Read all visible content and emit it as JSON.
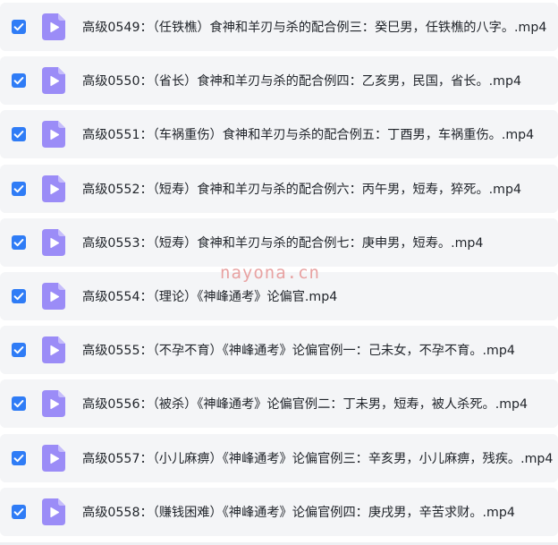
{
  "files": [
    {
      "checked": true,
      "name": "高级0549：（任铁樵）食神和羊刃与杀的配合例三：癸巳男，任铁樵的八字。.mp4"
    },
    {
      "checked": true,
      "name": "高级0550：（省长）食神和羊刃与杀的配合例四：乙亥男，民国，省长。.mp4"
    },
    {
      "checked": true,
      "name": "高级0551：（车祸重伤）食神和羊刃与杀的配合例五：丁酉男，车祸重伤。.mp4"
    },
    {
      "checked": true,
      "name": "高级0552：（短寿）食神和羊刃与杀的配合例六：丙午男，短寿，猝死。.mp4"
    },
    {
      "checked": true,
      "name": "高级0553：（短寿）食神和羊刃与杀的配合例七：庚申男，短寿。.mp4"
    },
    {
      "checked": true,
      "name": "高级0554：（理论）《神峰通考》论偏官.mp4"
    },
    {
      "checked": true,
      "name": "高级0555：（不孕不育）《神峰通考》论偏官例一：己未女，不孕不育。.mp4"
    },
    {
      "checked": true,
      "name": "高级0556：（被杀）《神峰通考》论偏官例二：丁未男，短寿，被人杀死。.mp4"
    },
    {
      "checked": true,
      "name": "高级0557：（小儿麻痹）《神峰通考》论偏官例三：辛亥男，小儿麻痹，残疾。.mp4"
    },
    {
      "checked": true,
      "name": "高级0558：（赚钱困难）《神峰通考》论偏官例四：庚戌男，辛苦求财。.mp4"
    }
  ],
  "icons": {
    "checkbox": "checkbox-checked-icon",
    "file": "video-file-icon"
  },
  "colors": {
    "checkbox": "#2f7cf6",
    "file_icon": "#9b8cf7",
    "file_icon_fold": "#c6bdfb",
    "row_background": "#f4f5f7",
    "text": "#1f2329"
  },
  "watermark": "nayona.cn"
}
